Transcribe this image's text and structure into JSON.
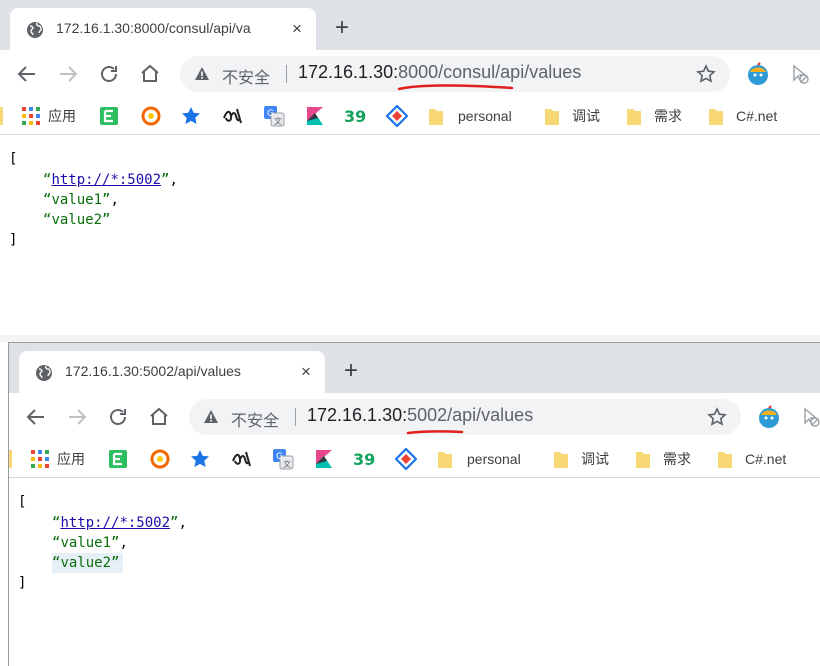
{
  "window1": {
    "tab": {
      "title": "172.16.1.30:8000/consul/api/va",
      "close": "×"
    },
    "newtab": "+",
    "omnibox": {
      "insecure": "不安全",
      "url_host": "172.16.1.30:",
      "url_rest": "8000/consul/api/values"
    },
    "body": {
      "open": "[",
      "items": [
        "http://*:5002",
        "value1",
        "value2"
      ],
      "close": "]"
    }
  },
  "window2": {
    "tab": {
      "title": "172.16.1.30:5002/api/values",
      "close": "×"
    },
    "newtab": "+",
    "omnibox": {
      "insecure": "不安全",
      "url_host": "172.16.1.30:",
      "url_rest": "5002/api/values"
    },
    "body": {
      "open": "[",
      "items": [
        "http://*:5002",
        "value1",
        "value2"
      ],
      "close": "]"
    }
  },
  "bookmarks": [
    {
      "label": "应用",
      "icon": "apps-grid-icon"
    },
    {
      "label": "",
      "icon": "evernote-icon"
    },
    {
      "label": "",
      "icon": "grafana-icon"
    },
    {
      "label": "",
      "icon": "star-icon"
    },
    {
      "label": "",
      "icon": "script-icon"
    },
    {
      "label": "",
      "icon": "translate-icon"
    },
    {
      "label": "",
      "icon": "kibana-icon"
    },
    {
      "label": "",
      "icon": "logo-39-icon"
    },
    {
      "label": "",
      "icon": "diamond-icon"
    },
    {
      "label": "personal",
      "icon": "folder-icon"
    },
    {
      "label": "调试",
      "icon": "folder-icon"
    },
    {
      "label": "需求",
      "icon": "folder-icon"
    },
    {
      "label": "C#.net",
      "icon": "folder-icon"
    }
  ],
  "punct": {
    "quote_open": "“",
    "quote_close": "”",
    "comma": ","
  },
  "colors": {
    "tabbar": "#dee1e6",
    "omnibox": "#f1f3f4",
    "string": "#0a6d0a",
    "link": "#1a0dab",
    "annotation": "#e02020"
  }
}
